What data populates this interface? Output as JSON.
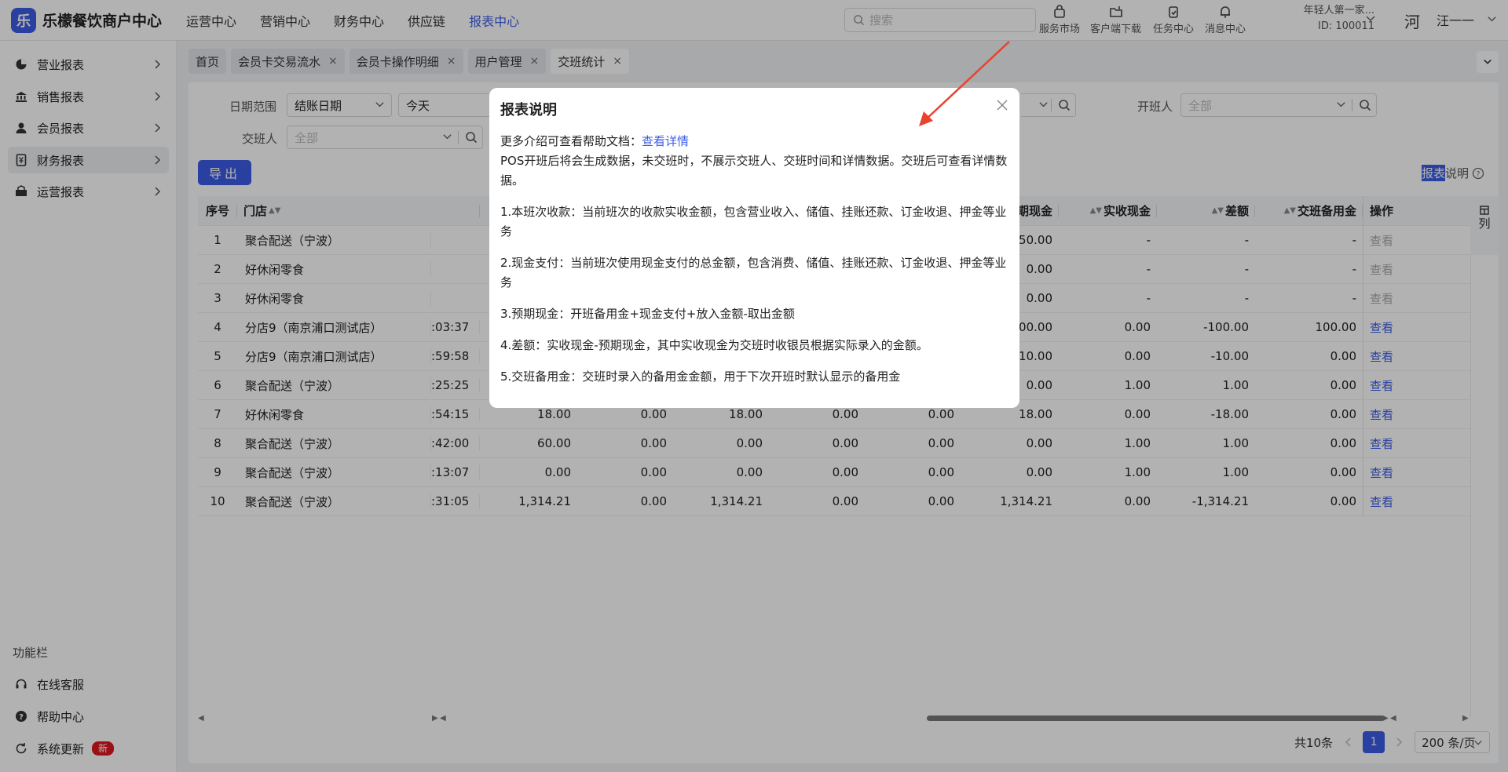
{
  "brand": {
    "logo_char": "乐",
    "name": "乐檬餐饮商户中心"
  },
  "top_nav": [
    {
      "label": "运营中心",
      "active": false
    },
    {
      "label": "营销中心",
      "active": false
    },
    {
      "label": "财务中心",
      "active": false
    },
    {
      "label": "供应链",
      "active": false
    },
    {
      "label": "报表中心",
      "active": true
    }
  ],
  "search": {
    "placeholder": "搜索"
  },
  "tools": {
    "service_market": "服务市场",
    "client_download": "客户端下载",
    "task_center": "任务中心",
    "message_center": "消息中心"
  },
  "tenant": {
    "name": "年轻人第一家...",
    "id": "ID: 100011"
  },
  "user": {
    "avatar_char": "河",
    "name": "汪一一"
  },
  "sidebar": {
    "items": [
      {
        "label": "营业报表"
      },
      {
        "label": "销售报表"
      },
      {
        "label": "会员报表"
      },
      {
        "label": "财务报表"
      },
      {
        "label": "运营报表"
      }
    ],
    "section_title": "功能栏",
    "bottom": {
      "online_service": "在线客服",
      "help_center": "帮助中心",
      "system_update": "系统更新",
      "new_badge": "新"
    }
  },
  "tabs": [
    {
      "label": "首页",
      "closable": false
    },
    {
      "label": "会员卡交易流水",
      "closable": true
    },
    {
      "label": "会员卡操作明细",
      "closable": true
    },
    {
      "label": "用户管理",
      "closable": true
    },
    {
      "label": "交班统计",
      "closable": true
    }
  ],
  "tab_close_glyph": "×",
  "filters": {
    "date_range_label": "日期范围",
    "date_type_value": "结账日期",
    "date_value": "今天",
    "opener_label": "开班人",
    "opener_placeholder": "全部",
    "handover_label": "交班人",
    "handover_placeholder": "全部"
  },
  "export_label": "导出",
  "report_note": {
    "highlight": "报表",
    "rest": "说明"
  },
  "table": {
    "headers": {
      "idx": "序号",
      "store": "门店",
      "expected_cash": "预期现金",
      "actual_cash": "实收现金",
      "difference": "差额",
      "reserve": "交班备用金",
      "action": "操作"
    },
    "column_toggle": "列",
    "rows": [
      {
        "idx": "1",
        "store": "聚合配送（宁波）",
        "time": "",
        "c1": "",
        "c2": "",
        "c3": "",
        "c4": "",
        "c5": "",
        "expected": "50.00",
        "actual": "-",
        "diff": "-",
        "reserve": "-",
        "action": "查看",
        "enabled": false
      },
      {
        "idx": "2",
        "store": "好休闲零食",
        "time": "",
        "c1": "",
        "c2": "",
        "c3": "",
        "c4": "",
        "c5": "",
        "expected": "0.00",
        "actual": "-",
        "diff": "-",
        "reserve": "-",
        "action": "查看",
        "enabled": false
      },
      {
        "idx": "3",
        "store": "好休闲零食",
        "time": "",
        "c1": "",
        "c2": "",
        "c3": "",
        "c4": "",
        "c5": "",
        "expected": "0.00",
        "actual": "-",
        "diff": "-",
        "reserve": "-",
        "action": "查看",
        "enabled": false
      },
      {
        "idx": "4",
        "store": "分店9（南京浦口测试店）",
        "time": ":03:37",
        "c1": "",
        "c2": "",
        "c3": "",
        "c4": "",
        "c5": "",
        "expected": "100.00",
        "actual": "0.00",
        "diff": "-100.00",
        "reserve": "100.00",
        "action": "查看",
        "enabled": true
      },
      {
        "idx": "5",
        "store": "分店9（南京浦口测试店）",
        "time": ":59:58",
        "c1": "",
        "c2": "",
        "c3": "",
        "c4": "",
        "c5": "",
        "expected": "10.00",
        "actual": "0.00",
        "diff": "-10.00",
        "reserve": "0.00",
        "action": "查看",
        "enabled": true
      },
      {
        "idx": "6",
        "store": "聚合配送（宁波）",
        "time": ":25:25",
        "c1": "",
        "c2": "",
        "c3": "",
        "c4": "",
        "c5": "",
        "expected": "0.00",
        "actual": "1.00",
        "diff": "1.00",
        "reserve": "0.00",
        "action": "查看",
        "enabled": true
      },
      {
        "idx": "7",
        "store": "好休闲零食",
        "time": ":54:15",
        "c1": "18.00",
        "c2": "0.00",
        "c3": "18.00",
        "c4": "0.00",
        "c5": "0.00",
        "expected": "18.00",
        "actual": "0.00",
        "diff": "-18.00",
        "reserve": "0.00",
        "action": "查看",
        "enabled": true
      },
      {
        "idx": "8",
        "store": "聚合配送（宁波）",
        "time": ":42:00",
        "c1": "60.00",
        "c2": "0.00",
        "c3": "0.00",
        "c4": "0.00",
        "c5": "0.00",
        "expected": "0.00",
        "actual": "1.00",
        "diff": "1.00",
        "reserve": "0.00",
        "action": "查看",
        "enabled": true
      },
      {
        "idx": "9",
        "store": "聚合配送（宁波）",
        "time": ":13:07",
        "c1": "0.00",
        "c2": "0.00",
        "c3": "0.00",
        "c4": "0.00",
        "c5": "0.00",
        "expected": "0.00",
        "actual": "1.00",
        "diff": "1.00",
        "reserve": "0.00",
        "action": "查看",
        "enabled": true
      },
      {
        "idx": "10",
        "store": "聚合配送（宁波）",
        "time": ":31:05",
        "c1": "1,314.21",
        "c2": "0.00",
        "c3": "1,314.21",
        "c4": "0.00",
        "c5": "0.00",
        "expected": "1,314.21",
        "actual": "0.00",
        "diff": "-1,314.21",
        "reserve": "0.00",
        "action": "查看",
        "enabled": true
      }
    ]
  },
  "pagination": {
    "total": "共10条",
    "current": "1",
    "page_size": "200 条/页"
  },
  "modal": {
    "title": "报表说明",
    "intro_prefix": "更多介绍可查看帮助文档：",
    "intro_link": "查看详情",
    "intro_text": "POS开班后将会生成数据，未交班时，不展示交班人、交班时间和详情数据。交班后可查看详情数据。",
    "items": [
      "1.本班次收款：当前班次的收款实收金额，包含营业收入、储值、挂账还款、订金收退、押金等业务",
      "2.现金支付：当前班次使用现金支付的总金额，包含消费、储值、挂账还款、订金收退、押金等业务",
      "3.预期现金：开班备用金+现金支付+放入金额-取出金额",
      "4.差额：实收现金-预期现金，其中实收现金为交班时收银员根据实际录入的金额。",
      "5.交班备用金：交班时录入的备用金金额，用于下次开班时默认显示的备用金"
    ]
  },
  "colors": {
    "accent": "#3c5ce6",
    "annotation_arrow": "#e8432d",
    "badge": "#e0161f"
  }
}
